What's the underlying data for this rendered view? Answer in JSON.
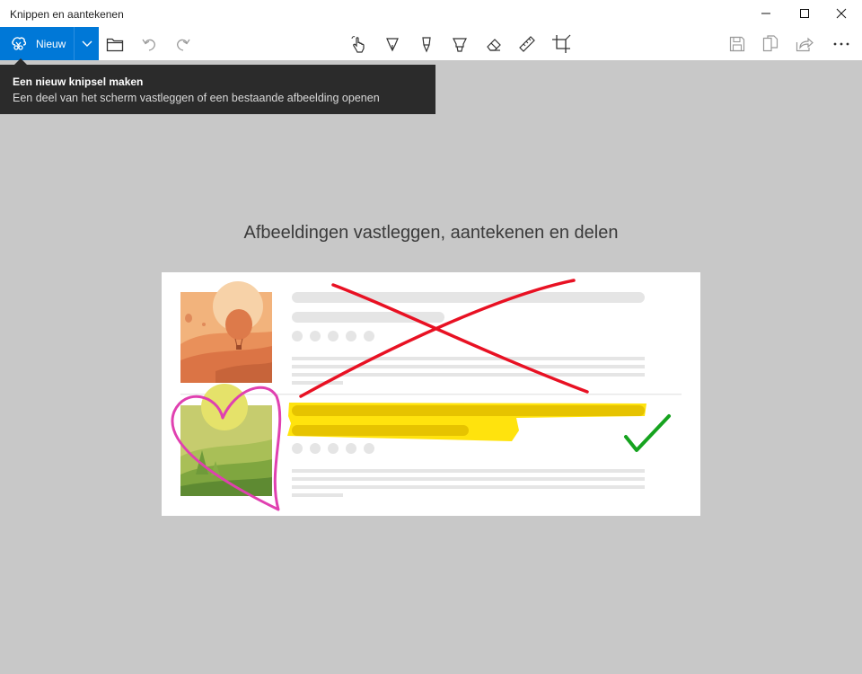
{
  "window": {
    "title": "Knippen en aantekenen",
    "controls": [
      "minimize-icon",
      "maximize-icon",
      "close-icon"
    ]
  },
  "toolbar": {
    "new_label": "Nieuw",
    "new_icon": "snip-icon",
    "dropdown_icon": "chevron-down-icon",
    "left_tools": [
      "open-folder-icon",
      "undo-icon",
      "redo-icon"
    ],
    "center_tools": [
      "touch-writing-icon",
      "ballpoint-pen-icon",
      "pencil-icon",
      "highlighter-icon",
      "eraser-icon",
      "ruler-icon",
      "crop-icon"
    ],
    "right_tools": [
      "save-icon",
      "copy-icon",
      "share-icon",
      "more-icon"
    ],
    "accent_color": "#0078d7"
  },
  "tooltip": {
    "title": "Een nieuw knipsel maken",
    "description": "Een deel van het scherm vastleggen of een bestaande afbeelding openen"
  },
  "main": {
    "heading": "Afbeeldingen vastleggen, aantekenen en delen",
    "background_color": "#c8c8c8"
  },
  "illustration": {
    "annotations": [
      "red-cross",
      "yellow-highlight",
      "pink-heart",
      "green-checkmark"
    ],
    "colors": {
      "red": "#e81123",
      "yellow": "#ffe100",
      "pink": "#e040b0",
      "green": "#16a31f"
    }
  }
}
